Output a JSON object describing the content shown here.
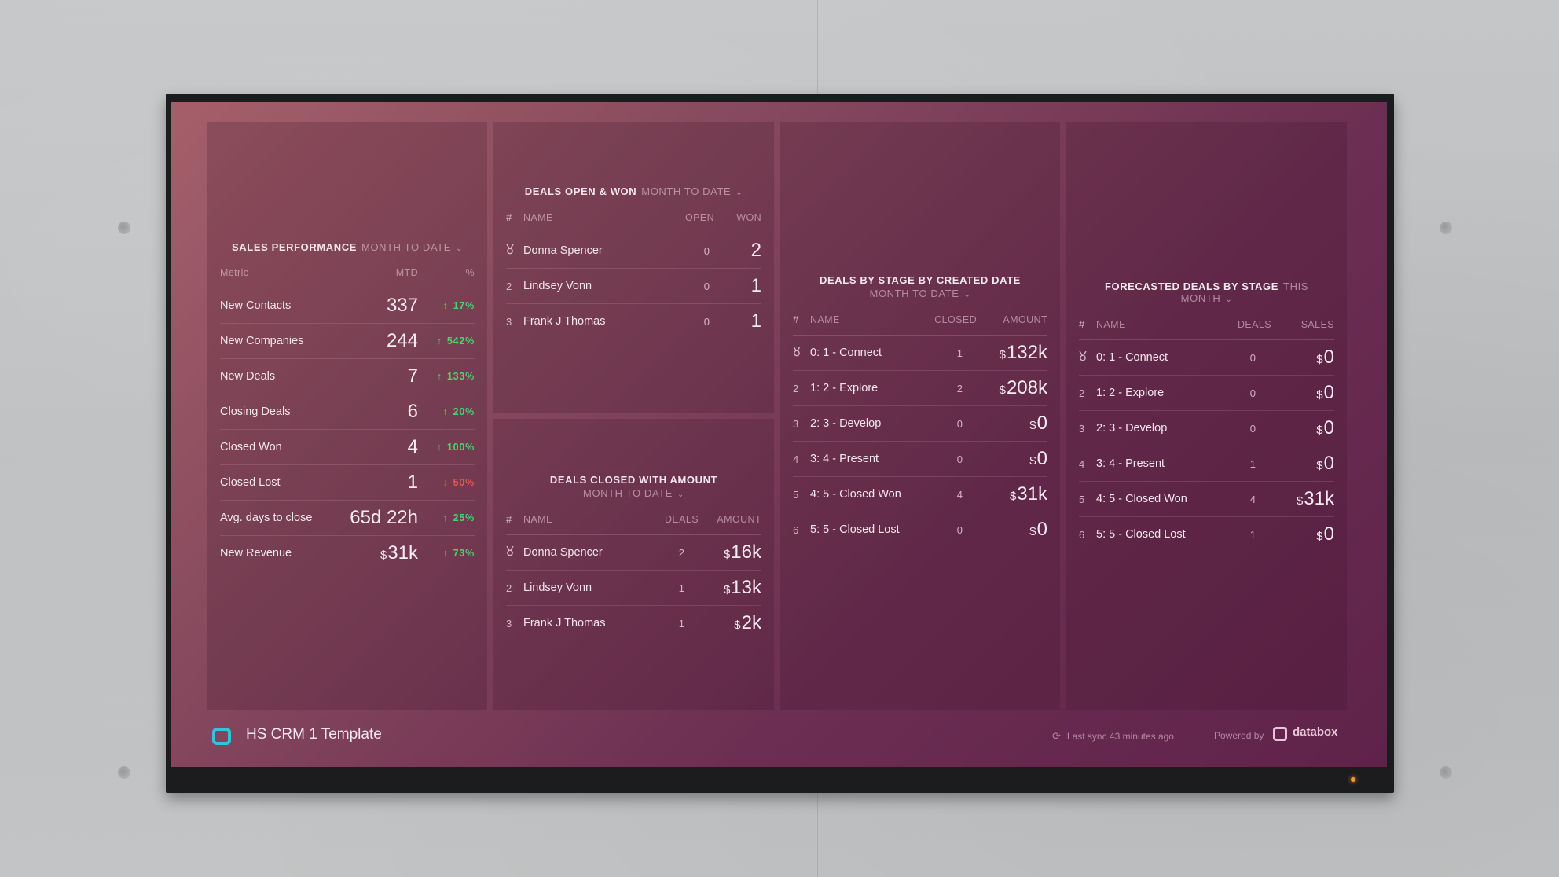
{
  "footer": {
    "dashboard_title": "HS CRM 1 Template",
    "sync_text": "Last sync 43 minutes ago",
    "powered_by": "Powered by",
    "brand": "databox"
  },
  "colors": {
    "accent_logo": "#35c2df",
    "positive": "#4bd36f",
    "negative": "#e7574f"
  },
  "sales_performance": {
    "title": "SALES PERFORMANCE",
    "range": "MONTH TO DATE",
    "columns": {
      "metric": "Metric",
      "mtd": "MTD",
      "pct": "%"
    },
    "rows": [
      {
        "metric": "New Contacts",
        "prefix": "",
        "value": "337",
        "arrow": "↑",
        "change": "17%",
        "trend": "up"
      },
      {
        "metric": "New Companies",
        "prefix": "",
        "value": "244",
        "arrow": "↑",
        "change": "542%",
        "trend": "up"
      },
      {
        "metric": "New Deals",
        "prefix": "",
        "value": "7",
        "arrow": "↑",
        "change": "133%",
        "trend": "up"
      },
      {
        "metric": "Closing Deals",
        "prefix": "",
        "value": "6",
        "arrow": "↑",
        "change": "20%",
        "trend": "up"
      },
      {
        "metric": "Closed Won",
        "prefix": "",
        "value": "4",
        "arrow": "↑",
        "change": "100%",
        "trend": "up"
      },
      {
        "metric": "Closed Lost",
        "prefix": "",
        "value": "1",
        "arrow": "↓",
        "change": "50%",
        "trend": "down"
      },
      {
        "metric": "Avg. days to close",
        "prefix": "",
        "value": "65d 22h",
        "arrow": "↑",
        "change": "25%",
        "trend": "up"
      },
      {
        "metric": "New Revenue",
        "prefix": "$",
        "value": "31k",
        "arrow": "↑",
        "change": "73%",
        "trend": "up"
      }
    ]
  },
  "deals_open_won": {
    "title": "DEALS OPEN & WON",
    "range": "MONTH TO DATE",
    "columns": {
      "rank": "#",
      "name": "NAME",
      "open": "OPEN",
      "won": "WON"
    },
    "rows": [
      {
        "rank": "medal",
        "name": "Donna Spencer",
        "open": "0",
        "won": "2"
      },
      {
        "rank": "2",
        "name": "Lindsey Vonn",
        "open": "0",
        "won": "1"
      },
      {
        "rank": "3",
        "name": "Frank J Thomas",
        "open": "0",
        "won": "1"
      }
    ]
  },
  "deals_closed_amount": {
    "title": "DEALS CLOSED WITH AMOUNT",
    "range": "MONTH TO DATE",
    "columns": {
      "rank": "#",
      "name": "NAME",
      "deals": "DEALS",
      "amount": "AMOUNT"
    },
    "rows": [
      {
        "rank": "medal",
        "name": "Donna Spencer",
        "deals": "2",
        "prefix": "$",
        "amount": "16k"
      },
      {
        "rank": "2",
        "name": "Lindsey Vonn",
        "deals": "1",
        "prefix": "$",
        "amount": "13k"
      },
      {
        "rank": "3",
        "name": "Frank J Thomas",
        "deals": "1",
        "prefix": "$",
        "amount": "2k"
      }
    ]
  },
  "deals_by_stage": {
    "title": "DEALS BY STAGE BY CREATED DATE",
    "range": "MONTH TO DATE",
    "columns": {
      "rank": "#",
      "name": "NAME",
      "closed": "CLOSED",
      "amount": "AMOUNT"
    },
    "rows": [
      {
        "rank": "medal",
        "name": "0: 1 - Connect",
        "closed": "1",
        "prefix": "$",
        "amount": "132k"
      },
      {
        "rank": "2",
        "name": "1: 2 - Explore",
        "closed": "2",
        "prefix": "$",
        "amount": "208k"
      },
      {
        "rank": "3",
        "name": "2: 3 - Develop",
        "closed": "0",
        "prefix": "$",
        "amount": "0"
      },
      {
        "rank": "4",
        "name": "3: 4 - Present",
        "closed": "0",
        "prefix": "$",
        "amount": "0"
      },
      {
        "rank": "5",
        "name": "4: 5 - Closed Won",
        "closed": "4",
        "prefix": "$",
        "amount": "31k"
      },
      {
        "rank": "6",
        "name": "5: 5 - Closed Lost",
        "closed": "0",
        "prefix": "$",
        "amount": "0"
      }
    ]
  },
  "forecasted_deals": {
    "title": "FORECASTED DEALS BY STAGE",
    "range": "THIS MONTH",
    "columns": {
      "rank": "#",
      "name": "NAME",
      "deals": "DEALS",
      "sales": "SALES"
    },
    "rows": [
      {
        "rank": "medal",
        "name": "0: 1 - Connect",
        "deals": "0",
        "prefix": "$",
        "sales": "0"
      },
      {
        "rank": "2",
        "name": "1: 2 - Explore",
        "deals": "0",
        "prefix": "$",
        "sales": "0"
      },
      {
        "rank": "3",
        "name": "2: 3 - Develop",
        "deals": "0",
        "prefix": "$",
        "sales": "0"
      },
      {
        "rank": "4",
        "name": "3: 4 - Present",
        "deals": "1",
        "prefix": "$",
        "sales": "0"
      },
      {
        "rank": "5",
        "name": "4: 5 - Closed Won",
        "deals": "4",
        "prefix": "$",
        "sales": "31k"
      },
      {
        "rank": "6",
        "name": "5: 5 - Closed Lost",
        "deals": "1",
        "prefix": "$",
        "sales": "0"
      }
    ]
  }
}
